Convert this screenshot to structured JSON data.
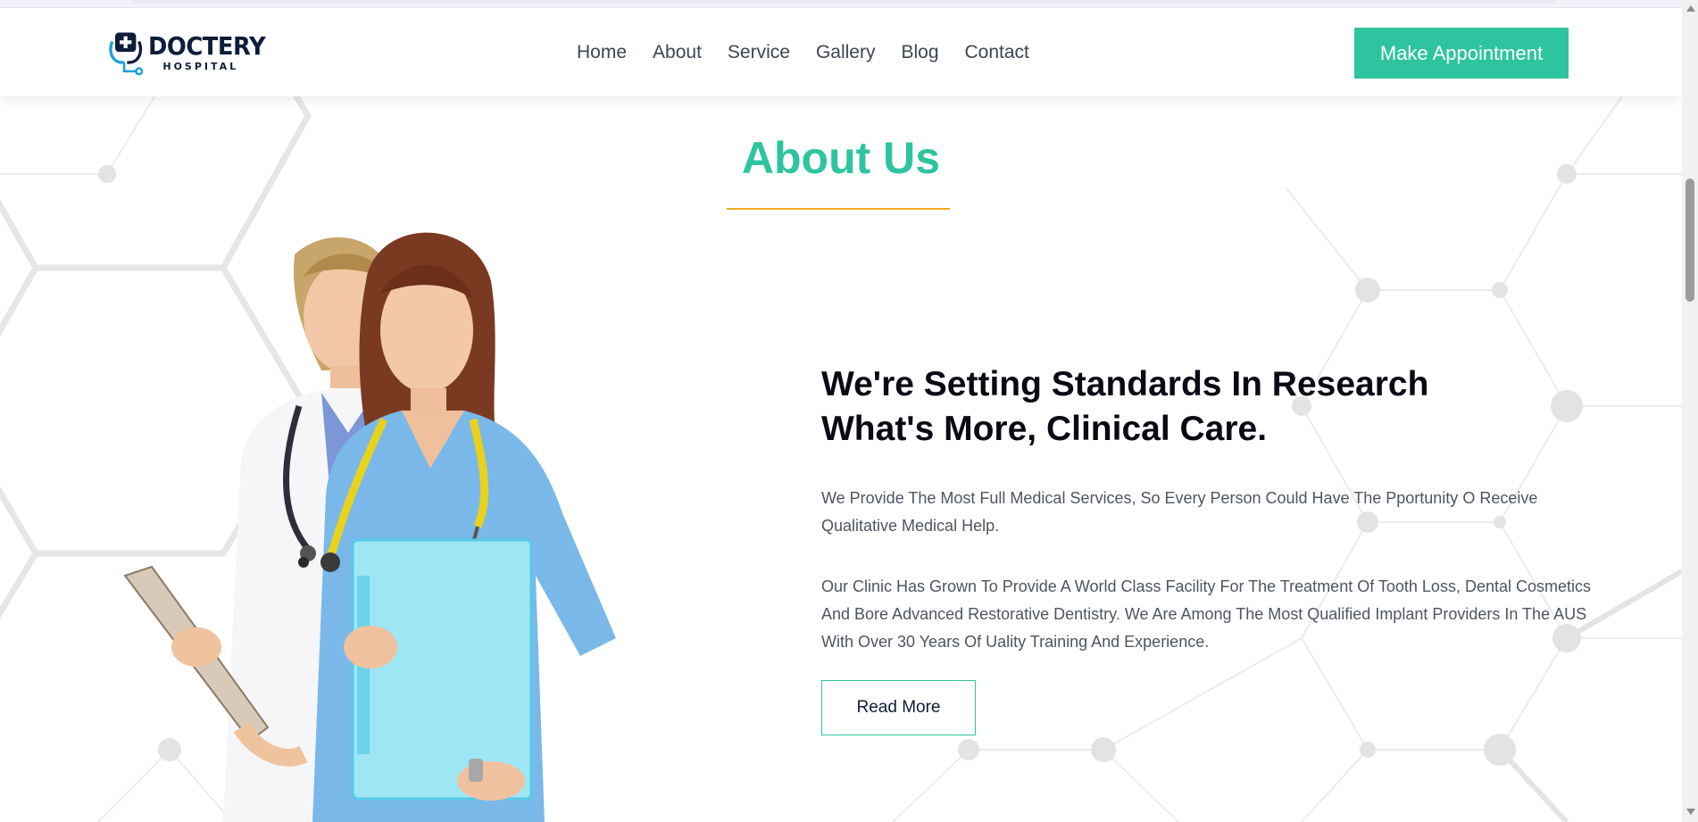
{
  "brand": {
    "name": "DOCTERY",
    "subtitle": "HOSPITAL"
  },
  "nav": {
    "items": [
      "Home",
      "About",
      "Service",
      "Gallery",
      "Blog",
      "Contact"
    ],
    "cta_label": "Make Appointment"
  },
  "about": {
    "title": "About Us",
    "headline_line1": "We're Setting Standards In Research",
    "headline_line2": "What's More, Clinical Care.",
    "paragraph1": "We Provide The Most Full Medical Services, So Every Person Could Have The Pportunity O Receive Qualitative Medical Help.",
    "paragraph2": "Our Clinic Has Grown To Provide A World Class Facility For The Treatment Of Tooth Loss, Dental Cosmetics And Bore Advanced Restorative Dentistry. We Are Among The Most Qualified Implant Providers In The AUS With Over 30 Years Of Uality Training And Experience.",
    "read_more_label": "Read More"
  },
  "colors": {
    "accent": "#2ec4a0",
    "underline": "#f2a91d",
    "brand_dark": "#0f1d3a",
    "body_text": "#4e5560"
  },
  "icons": {
    "logo": "stethoscope-cross-icon"
  }
}
